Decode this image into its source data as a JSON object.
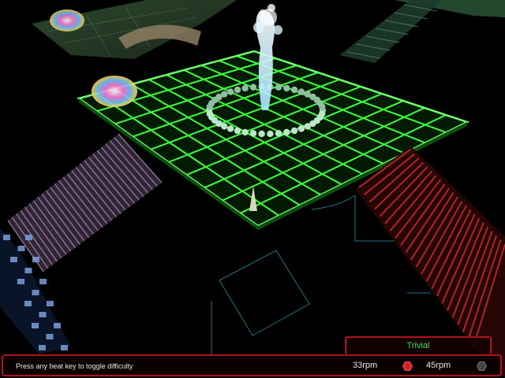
{
  "hud": {
    "difficulty": "Trivial",
    "hint": "Press any beat key to toggle difficulty",
    "speeds": [
      {
        "label": "33rpm",
        "selected": true
      },
      {
        "label": "45rpm",
        "selected": false
      }
    ]
  },
  "colors": {
    "grid": "#3cff3c",
    "hud_border": "#b0141a",
    "difficulty_text": "#34e05a",
    "selected_indicator": "#d8222a",
    "unselected_indicator": "#555555"
  }
}
